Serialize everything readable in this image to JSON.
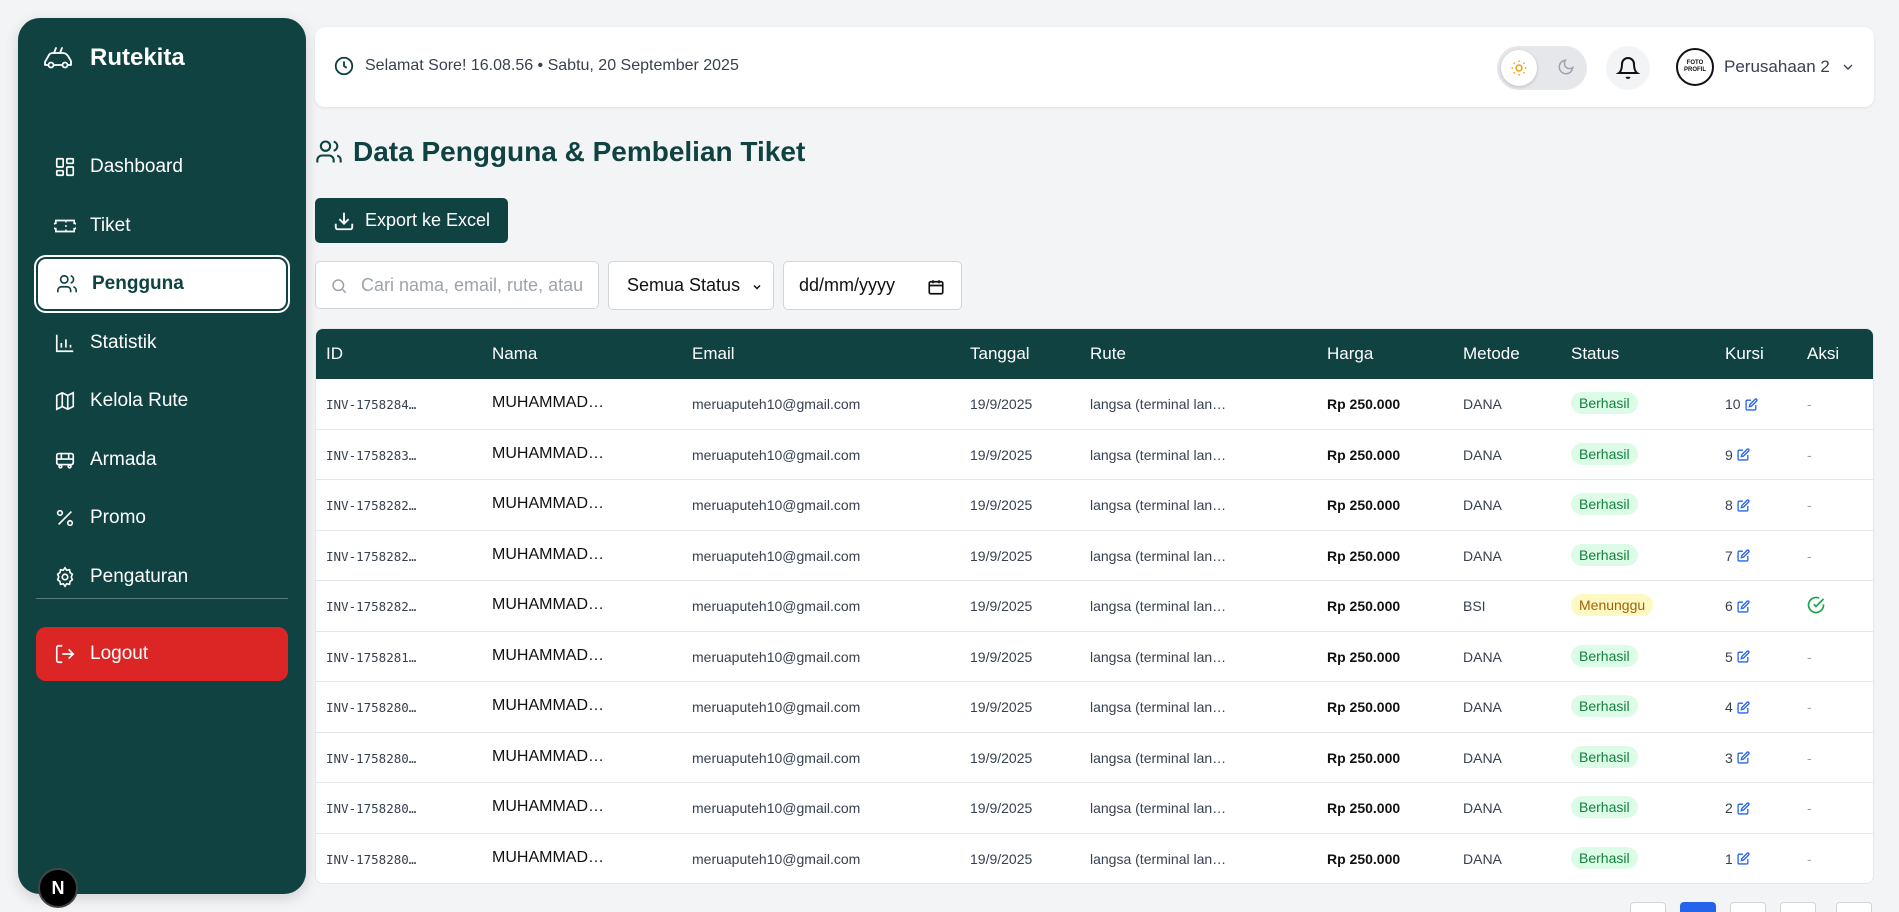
{
  "app": {
    "name": "Rutekita"
  },
  "sidebar": {
    "items": [
      {
        "label": "Dashboard",
        "icon": "dashboard-icon"
      },
      {
        "label": "Tiket",
        "icon": "ticket-icon"
      },
      {
        "label": "Pengguna",
        "icon": "users-icon",
        "active": true
      },
      {
        "label": "Statistik",
        "icon": "chart-icon"
      },
      {
        "label": "Kelola Rute",
        "icon": "map-icon"
      },
      {
        "label": "Armada",
        "icon": "bus-icon"
      },
      {
        "label": "Promo",
        "icon": "percent-icon"
      },
      {
        "label": "Pengaturan",
        "icon": "gear-icon"
      }
    ],
    "logout_label": "Logout",
    "corner_badge": "N"
  },
  "header": {
    "greeting": "Selamat Sore! 16.08.56 • Sabtu, 20 September 2025",
    "profile_name": "Perusahaan 2",
    "avatar_line1": "FOTO",
    "avatar_line2": "PROFIL"
  },
  "page": {
    "title": "Data Pengguna & Pembelian Tiket",
    "export_label": "Export ke Excel"
  },
  "filters": {
    "search_placeholder": "Cari nama, email, rute, atau",
    "status_selected": "Semua Status",
    "date_placeholder": "dd/mm/yyyy"
  },
  "table": {
    "headers": [
      "ID",
      "Nama",
      "Email",
      "Tanggal",
      "Rute",
      "Harga",
      "Metode",
      "Status",
      "Kursi",
      "Aksi"
    ],
    "rows": [
      {
        "id": "INV-1758284…",
        "nama": "MUHAMMAD…",
        "email": "meruaputeh10@gmail.com",
        "tanggal": "19/9/2025",
        "rute": "langsa (terminal lan…",
        "harga": "Rp 250.000",
        "metode": "DANA",
        "status": "Berhasil",
        "kursi": "10",
        "aksi": "-"
      },
      {
        "id": "INV-1758283…",
        "nama": "MUHAMMAD…",
        "email": "meruaputeh10@gmail.com",
        "tanggal": "19/9/2025",
        "rute": "langsa (terminal lan…",
        "harga": "Rp 250.000",
        "metode": "DANA",
        "status": "Berhasil",
        "kursi": "9",
        "aksi": "-"
      },
      {
        "id": "INV-1758282…",
        "nama": "MUHAMMAD…",
        "email": "meruaputeh10@gmail.com",
        "tanggal": "19/9/2025",
        "rute": "langsa (terminal lan…",
        "harga": "Rp 250.000",
        "metode": "DANA",
        "status": "Berhasil",
        "kursi": "8",
        "aksi": "-"
      },
      {
        "id": "INV-1758282…",
        "nama": "MUHAMMAD…",
        "email": "meruaputeh10@gmail.com",
        "tanggal": "19/9/2025",
        "rute": "langsa (terminal lan…",
        "harga": "Rp 250.000",
        "metode": "DANA",
        "status": "Berhasil",
        "kursi": "7",
        "aksi": "-"
      },
      {
        "id": "INV-1758282…",
        "nama": "MUHAMMAD…",
        "email": "meruaputeh10@gmail.com",
        "tanggal": "19/9/2025",
        "rute": "langsa (terminal lan…",
        "harga": "Rp 250.000",
        "metode": "BSI",
        "status": "Menunggu",
        "kursi": "6",
        "aksi": "check"
      },
      {
        "id": "INV-1758281…",
        "nama": "MUHAMMAD…",
        "email": "meruaputeh10@gmail.com",
        "tanggal": "19/9/2025",
        "rute": "langsa (terminal lan…",
        "harga": "Rp 250.000",
        "metode": "DANA",
        "status": "Berhasil",
        "kursi": "5",
        "aksi": "-"
      },
      {
        "id": "INV-1758280…",
        "nama": "MUHAMMAD…",
        "email": "meruaputeh10@gmail.com",
        "tanggal": "19/9/2025",
        "rute": "langsa (terminal lan…",
        "harga": "Rp 250.000",
        "metode": "DANA",
        "status": "Berhasil",
        "kursi": "4",
        "aksi": "-"
      },
      {
        "id": "INV-1758280…",
        "nama": "MUHAMMAD…",
        "email": "meruaputeh10@gmail.com",
        "tanggal": "19/9/2025",
        "rute": "langsa (terminal lan…",
        "harga": "Rp 250.000",
        "metode": "DANA",
        "status": "Berhasil",
        "kursi": "3",
        "aksi": "-"
      },
      {
        "id": "INV-1758280…",
        "nama": "MUHAMMAD…",
        "email": "meruaputeh10@gmail.com",
        "tanggal": "19/9/2025",
        "rute": "langsa (terminal lan…",
        "harga": "Rp 250.000",
        "metode": "DANA",
        "status": "Berhasil",
        "kursi": "2",
        "aksi": "-"
      },
      {
        "id": "INV-1758280…",
        "nama": "MUHAMMAD…",
        "email": "meruaputeh10@gmail.com",
        "tanggal": "19/9/2025",
        "rute": "langsa (terminal lan…",
        "harga": "Rp 250.000",
        "metode": "DANA",
        "status": "Berhasil",
        "kursi": "1",
        "aksi": "-"
      }
    ]
  },
  "colors": {
    "primary": "#0f4241",
    "danger": "#dc2626",
    "success_bg": "#dcfce7",
    "success_text": "#15803d",
    "warning_bg": "#fef9c3",
    "warning_text": "#a16207",
    "accent_blue": "#2563eb"
  }
}
